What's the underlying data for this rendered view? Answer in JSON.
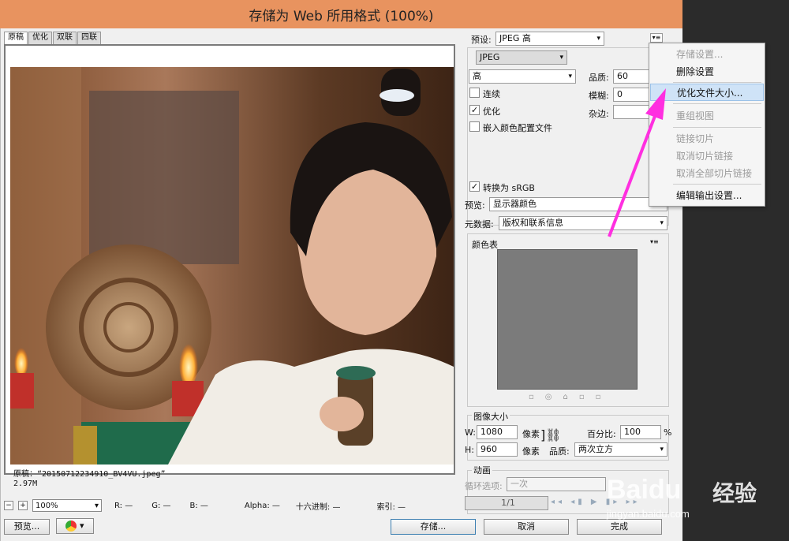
{
  "window": {
    "title": "存储为 Web 所用格式 (100%)"
  },
  "tabs": [
    "原稿",
    "优化",
    "双联",
    "四联"
  ],
  "preview": {
    "caption_line1": "原稿：“20150712234910_BV4VU.jpeg”",
    "caption_line2": "2.97M"
  },
  "status": {
    "zoom": "100%",
    "r": "R: —",
    "g": "G: —",
    "b": "B: —",
    "alpha": "Alpha: —",
    "hex": "十六进制: —",
    "index": "索引: —"
  },
  "buttons": {
    "preview": "预览...",
    "save": "存储...",
    "cancel": "取消",
    "done": "完成"
  },
  "settings": {
    "preset_label": "预设:",
    "preset_value": "JPEG 高",
    "format_value": "JPEG",
    "quality_preset": "高",
    "quality_label": "品质:",
    "quality_value": "60",
    "blur_label": "模糊:",
    "blur_value": "0",
    "matte_label": "杂边:",
    "progressive": "连续",
    "optimized": "优化",
    "embed_profile": "嵌入颜色配置文件",
    "convert_srgb": "转换为 sRGB",
    "preview_label": "预览:",
    "preview_value": "显示器颜色",
    "metadata_label": "元数据:",
    "metadata_value": "版权和联系信息",
    "color_table": "颜色表",
    "image_size": "图像大小",
    "w_label": "W:",
    "w_value": "1080",
    "h_label": "H:",
    "h_value": "960",
    "px": "像素",
    "percent_label": "百分比:",
    "percent_value": "100",
    "percent_unit": "%",
    "resample_label": "品质:",
    "resample_value": "两次立方",
    "animation": "动画",
    "loop_label": "循环选项:",
    "loop_value": "一次",
    "frame": "1/1"
  },
  "menu": {
    "items": [
      {
        "label": "存储设置...",
        "disabled": true
      },
      {
        "label": "删除设置",
        "disabled": false
      },
      {
        "label": "优化文件大小...",
        "disabled": false,
        "highlighted": true
      },
      {
        "label": "重组视图",
        "disabled": true
      },
      {
        "label": "链接切片",
        "disabled": true
      },
      {
        "label": "取消切片链接",
        "disabled": true
      },
      {
        "label": "取消全部切片链接",
        "disabled": true
      },
      {
        "label": "编辑输出设置...",
        "disabled": false
      }
    ]
  },
  "watermark": {
    "brand": "Baidu",
    "brand_cn": "经验",
    "url": "jingyan.baidu.com"
  },
  "colors": {
    "title_bar": "#e8935f",
    "arrow": "#ff2fe0",
    "highlight": "#cfe3f7"
  }
}
